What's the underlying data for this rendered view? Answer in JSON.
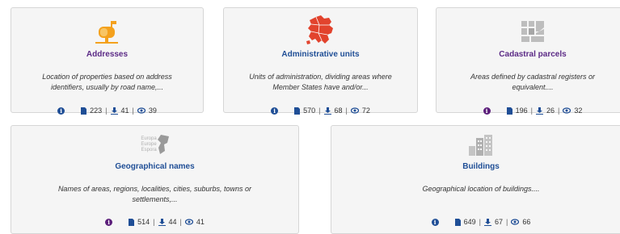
{
  "colors": {
    "title_purple": "#5b2a86",
    "title_blue": "#1f4e96",
    "info_blue": "#1f4e96",
    "info_purple": "#5b1e7a"
  },
  "cards": [
    {
      "title": "Addresses",
      "desc1": "Location of properties based on address",
      "desc2": "identifiers, usually by road name,...",
      "documents": "223",
      "downloads": "41",
      "views": "39",
      "icon": "mailbox-icon"
    },
    {
      "title": "Administrative units",
      "desc1": "Units of administration, dividing areas where",
      "desc2": "Member States have and/or...",
      "documents": "570",
      "downloads": "68",
      "views": "72",
      "icon": "europe-map-icon"
    },
    {
      "title": "Cadastral parcels",
      "desc1": "Areas defined by cadastral registers or",
      "desc2": "equivalent....",
      "documents": "196",
      "downloads": "26",
      "views": "32",
      "icon": "parcels-icon"
    },
    {
      "title": "Geographical names",
      "desc1": "Names of areas, regions, localities, cities, suburbs, towns or",
      "desc2": "settlements,...",
      "documents": "514",
      "downloads": "44",
      "views": "41",
      "icon": "place-names-icon",
      "logo_lines": [
        "Europa",
        "Europe",
        "Espora"
      ]
    },
    {
      "title": "Buildings",
      "desc1": "Geographical location of buildings....",
      "desc2": "",
      "documents": "649",
      "downloads": "67",
      "views": "66",
      "icon": "buildings-icon"
    }
  ]
}
